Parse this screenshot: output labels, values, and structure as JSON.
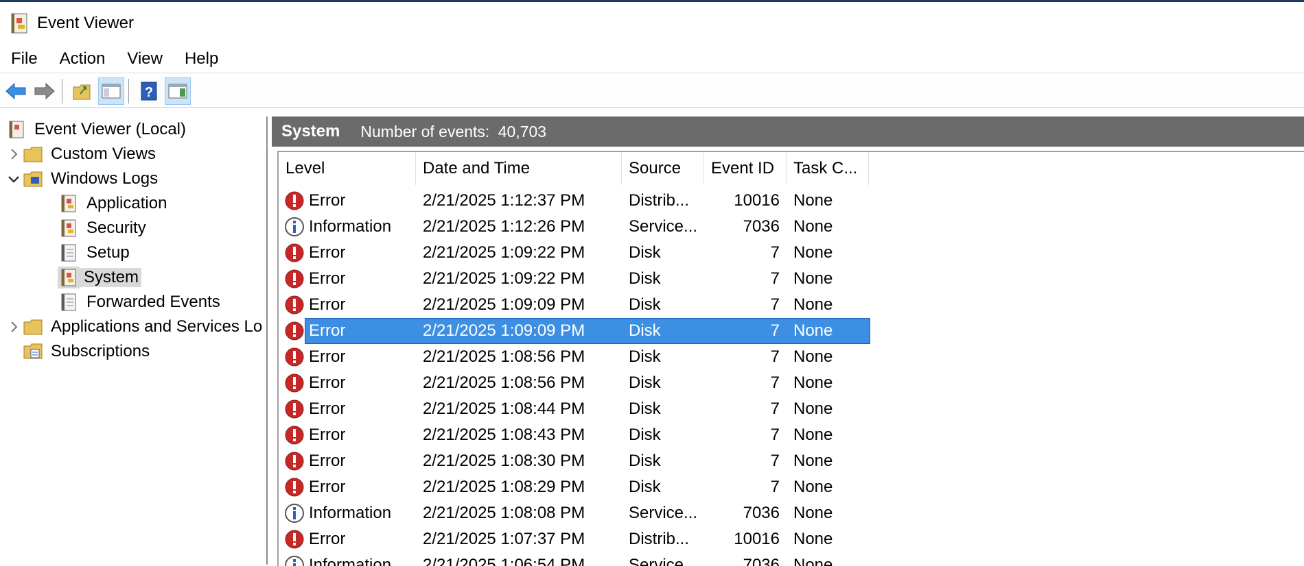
{
  "window": {
    "title": "Event Viewer"
  },
  "menu": [
    "File",
    "Action",
    "View",
    "Help"
  ],
  "toolbar": {
    "buttons": [
      {
        "icon": "back-arrow-icon"
      },
      {
        "icon": "forward-arrow-icon"
      },
      {
        "icon": "open-saved-log-icon"
      },
      {
        "icon": "show-hide-console-tree-icon",
        "toggled": true
      },
      {
        "icon": "help-icon"
      },
      {
        "icon": "show-hide-action-pane-icon",
        "toggled": true
      }
    ]
  },
  "tree": {
    "root": "Event Viewer (Local)",
    "custom_views": "Custom Views",
    "windows_logs": "Windows Logs",
    "application": "Application",
    "security": "Security",
    "setup": "Setup",
    "system": "System",
    "forwarded": "Forwarded Events",
    "apps_services": "Applications and Services Lo",
    "subscriptions": "Subscriptions"
  },
  "log": {
    "name": "System",
    "count_label": "Number of events:",
    "count": "40,703"
  },
  "columns": [
    "Level",
    "Date and Time",
    "Source",
    "Event ID",
    "Task C..."
  ],
  "rows": [
    {
      "level": "Error",
      "date": "2/21/2025 1:12:37 PM",
      "source": "Distrib...",
      "id": "10016",
      "task": "None"
    },
    {
      "level": "Information",
      "date": "2/21/2025 1:12:26 PM",
      "source": "Service...",
      "id": "7036",
      "task": "None"
    },
    {
      "level": "Error",
      "date": "2/21/2025 1:09:22 PM",
      "source": "Disk",
      "id": "7",
      "task": "None"
    },
    {
      "level": "Error",
      "date": "2/21/2025 1:09:22 PM",
      "source": "Disk",
      "id": "7",
      "task": "None"
    },
    {
      "level": "Error",
      "date": "2/21/2025 1:09:09 PM",
      "source": "Disk",
      "id": "7",
      "task": "None"
    },
    {
      "level": "Error",
      "date": "2/21/2025 1:09:09 PM",
      "source": "Disk",
      "id": "7",
      "task": "None",
      "selected": true
    },
    {
      "level": "Error",
      "date": "2/21/2025 1:08:56 PM",
      "source": "Disk",
      "id": "7",
      "task": "None"
    },
    {
      "level": "Error",
      "date": "2/21/2025 1:08:56 PM",
      "source": "Disk",
      "id": "7",
      "task": "None"
    },
    {
      "level": "Error",
      "date": "2/21/2025 1:08:44 PM",
      "source": "Disk",
      "id": "7",
      "task": "None"
    },
    {
      "level": "Error",
      "date": "2/21/2025 1:08:43 PM",
      "source": "Disk",
      "id": "7",
      "task": "None"
    },
    {
      "level": "Error",
      "date": "2/21/2025 1:08:30 PM",
      "source": "Disk",
      "id": "7",
      "task": "None"
    },
    {
      "level": "Error",
      "date": "2/21/2025 1:08:29 PM",
      "source": "Disk",
      "id": "7",
      "task": "None"
    },
    {
      "level": "Information",
      "date": "2/21/2025 1:08:08 PM",
      "source": "Service...",
      "id": "7036",
      "task": "None"
    },
    {
      "level": "Error",
      "date": "2/21/2025 1:07:37 PM",
      "source": "Distrib...",
      "id": "10016",
      "task": "None"
    },
    {
      "level": "Information",
      "date": "2/21/2025 1:06:54 PM",
      "source": "Service...",
      "id": "7036",
      "task": "None"
    }
  ],
  "colors": {
    "selection": "#3d8fe3",
    "error": "#c62828",
    "header_bar": "#6b6b6b"
  }
}
